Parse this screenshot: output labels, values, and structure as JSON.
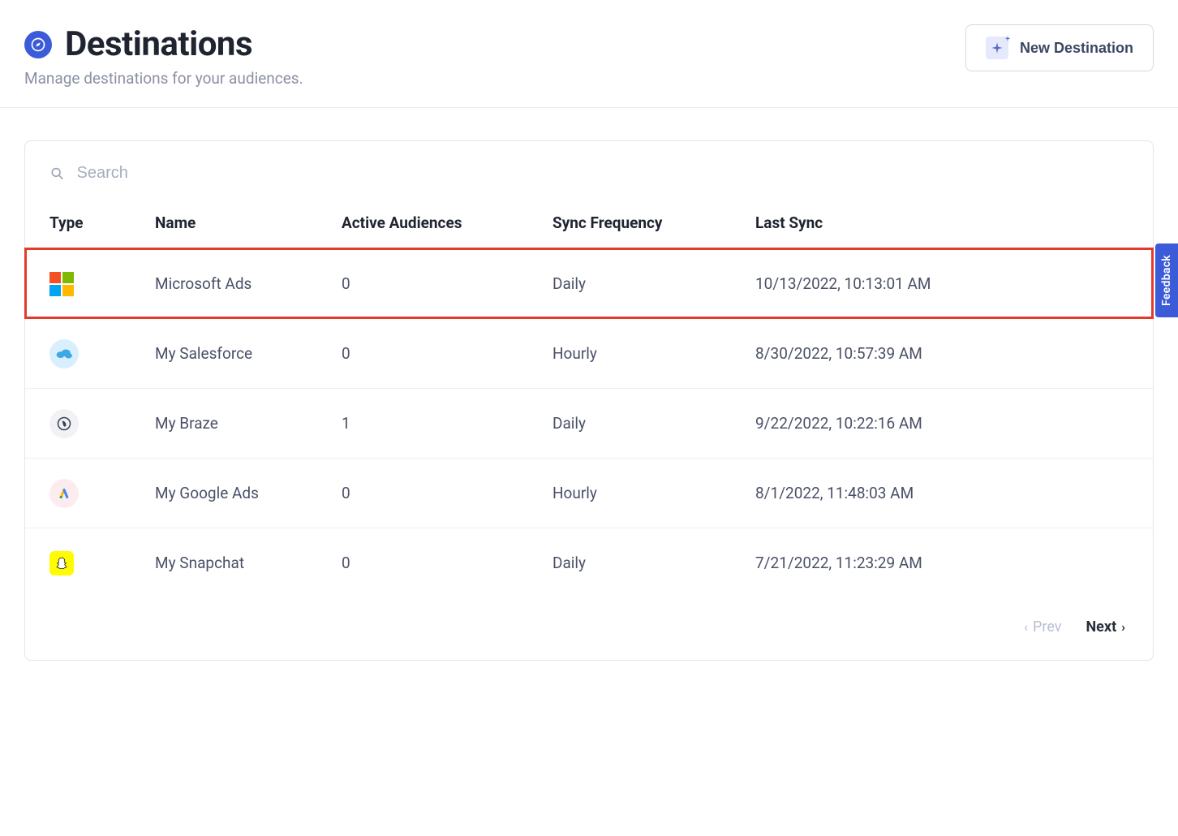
{
  "header": {
    "title": "Destinations",
    "subtitle": "Manage destinations for your audiences.",
    "new_button_label": "New Destination"
  },
  "search": {
    "placeholder": "Search"
  },
  "columns": {
    "type": "Type",
    "name": "Name",
    "active_audiences": "Active Audiences",
    "sync_frequency": "Sync Frequency",
    "last_sync": "Last Sync"
  },
  "rows": [
    {
      "icon": "microsoft-icon",
      "name": "Microsoft Ads",
      "active_audiences": "0",
      "sync_frequency": "Daily",
      "last_sync": "10/13/2022, 10:13:01 AM",
      "highlight": true
    },
    {
      "icon": "salesforce-icon",
      "name": "My Salesforce",
      "active_audiences": "0",
      "sync_frequency": "Hourly",
      "last_sync": "8/30/2022, 10:57:39 AM",
      "highlight": false
    },
    {
      "icon": "braze-icon",
      "name": "My Braze",
      "active_audiences": "1",
      "sync_frequency": "Daily",
      "last_sync": "9/22/2022, 10:22:16 AM",
      "highlight": false
    },
    {
      "icon": "google-ads-icon",
      "name": "My Google Ads",
      "active_audiences": "0",
      "sync_frequency": "Hourly",
      "last_sync": "8/1/2022, 11:48:03 AM",
      "highlight": false
    },
    {
      "icon": "snapchat-icon",
      "name": "My Snapchat",
      "active_audiences": "0",
      "sync_frequency": "Daily",
      "last_sync": "7/21/2022, 11:23:29 AM",
      "highlight": false
    }
  ],
  "pagination": {
    "prev_label": "Prev",
    "next_label": "Next"
  },
  "feedback": {
    "label": "Feedback"
  }
}
